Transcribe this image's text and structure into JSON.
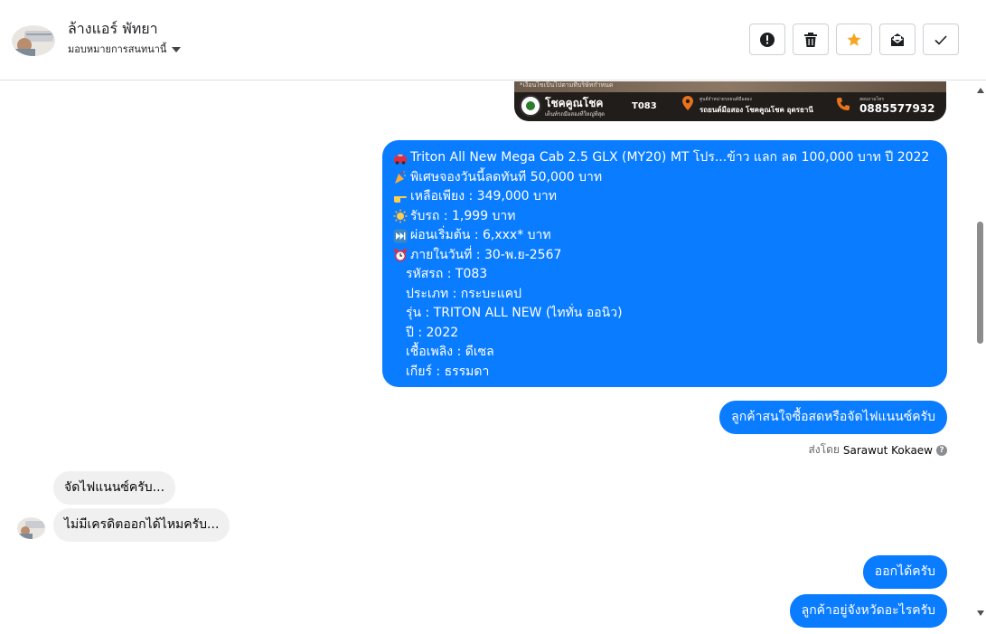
{
  "header": {
    "contact_name": "ล้างแอร์ พัทยา",
    "assign_label": "มอบหมายการสนทนานี้",
    "toolbar": [
      {
        "name": "spam-alert-button",
        "icon": "alert-circle-icon"
      },
      {
        "name": "delete-button",
        "icon": "trash-icon"
      },
      {
        "name": "star-button",
        "icon": "star-icon"
      },
      {
        "name": "mark-unread-button",
        "icon": "envelope-open-icon"
      },
      {
        "name": "mark-done-button",
        "icon": "check-icon"
      }
    ]
  },
  "banner": {
    "top_note": "*เงื่อนไขเป็นไปตามที่บริษัทกำหนด",
    "brand": "โชคคูณโชค",
    "tagline": "เต็นท์รถมือสองที่ใหญ่ที่สุด",
    "code": "T083",
    "location_small": "ศูนย์จำหน่ายรถยนต์มือสอง",
    "location": "รถยนต์มือสอง โชคคูณโชค อุดรธานี",
    "phone_small": "สอบถามโทร",
    "phone": "0885577932"
  },
  "messages": {
    "car_offer_lines": [
      {
        "emoji": "car",
        "text": "Triton All New Mega Cab 2.5 GLX (MY20) MT โปร...ข้าว แลก ลด 100,000 บาท ปี 2022"
      },
      {
        "emoji": "party",
        "text": " พิเศษจองวันนี้ลดทันที 50,000 บาท"
      },
      {
        "emoji": "point",
        "text": " เหลือเพียง : 349,000 บาท"
      },
      {
        "emoji": "sun",
        "text": " รับรถ : 1,999 บาท"
      },
      {
        "emoji": "fast",
        "text": "  ผ่อนเริ่มต้น : 6,xxx* บาท"
      },
      {
        "emoji": "clock",
        "text": " ภายในวันที่ : 30-พ.ย-2567"
      }
    ],
    "car_detail_lines": [
      "รหัสรถ : T083",
      "ประเภท : กระบะแคป",
      "รุ่น : TRITON ALL NEW (ไททั่น ออนิว)",
      "ปี : 2022",
      "เชื้อเพลิง : ดีเซล",
      "เกียร์ : ธรรมดา"
    ],
    "out_question": "ลูกค้าสนใจซื้อสดหรือจัดไฟแนนซ์ครับ",
    "sent_by_label": "ส่งโดย",
    "sent_by_name": "Sarawut Kokaew",
    "in_1": "จัดไฟแนนซ์ครับ...",
    "in_2": "ไม่มีเครดิตออกได้ไหมครับ...",
    "out_reply_1": "ออกได้ครับ",
    "out_reply_2": "ลูกค้าอยู่จังหวัดอะไรครับ"
  },
  "colors": {
    "outgoing_bubble": "#0a7cff",
    "incoming_bubble": "#f0f0f0",
    "star_accent": "#f5a623"
  }
}
